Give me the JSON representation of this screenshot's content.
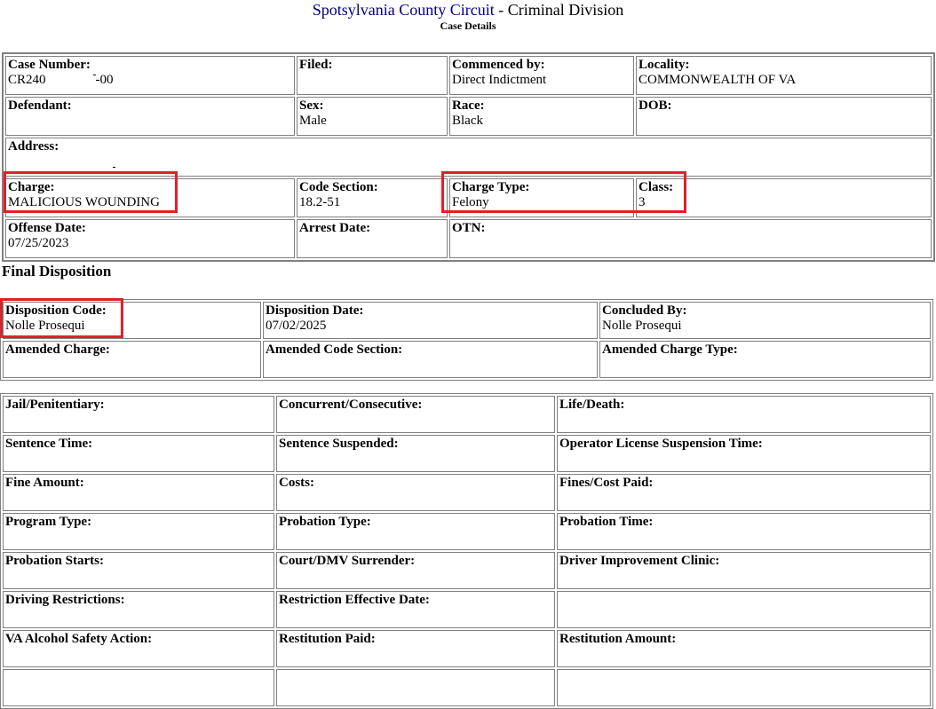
{
  "header": {
    "court": "Spotsylvania County Circuit",
    "division": "- Criminal Division",
    "subtitle": "Case Details"
  },
  "case": {
    "case_number_label": "Case Number:",
    "case_number_prefix": "CR240",
    "case_number_suffix": "-00",
    "filed_label": "Filed:",
    "filed": "",
    "commenced_label": "Commenced by:",
    "commenced": "Direct Indictment",
    "locality_label": "Locality:",
    "locality": "COMMONWEALTH OF VA",
    "defendant_label": "Defendant:",
    "defendant": "",
    "sex_label": "Sex:",
    "sex": "Male",
    "race_label": "Race:",
    "race": "Black",
    "dob_label": "DOB:",
    "dob": "",
    "address_label": "Address:",
    "address": "",
    "charge_label": "Charge:",
    "charge": "MALICIOUS WOUNDING",
    "code_section_label": "Code Section:",
    "code_section": "18.2-51",
    "charge_type_label": "Charge Type:",
    "charge_type": "Felony",
    "class_label": "Class:",
    "class": "3",
    "offense_date_label": "Offense Date:",
    "offense_date": "07/25/2023",
    "arrest_date_label": "Arrest Date:",
    "arrest_date": "",
    "otn_label": "OTN:",
    "otn": ""
  },
  "final_disposition": {
    "heading": "Final Disposition",
    "disposition_code_label": "Disposition Code:",
    "disposition_code": "Nolle Prosequi",
    "disposition_date_label": "Disposition Date:",
    "disposition_date": "07/02/2025",
    "concluded_by_label": "Concluded By:",
    "concluded_by": "Nolle Prosequi",
    "amended_charge_label": "Amended Charge:",
    "amended_code_section_label": "Amended Code Section:",
    "amended_charge_type_label": "Amended Charge Type:"
  },
  "sentencing": {
    "rows": [
      [
        "Jail/Penitentiary:",
        "Concurrent/Consecutive:",
        "Life/Death:"
      ],
      [
        "Sentence Time:",
        "Sentence Suspended:",
        "Operator License Suspension Time:"
      ],
      [
        "Fine Amount:",
        "Costs:",
        "Fines/Cost Paid:"
      ],
      [
        "Program Type:",
        "Probation Type:",
        "Probation Time:"
      ],
      [
        "Probation Starts:",
        "Court/DMV Surrender:",
        "Driver Improvement Clinic:"
      ],
      [
        "Driving Restrictions:",
        "Restriction Effective Date:",
        ""
      ],
      [
        "VA Alcohol Safety Action:",
        "Restitution Paid:",
        "Restitution Amount:"
      ]
    ]
  }
}
